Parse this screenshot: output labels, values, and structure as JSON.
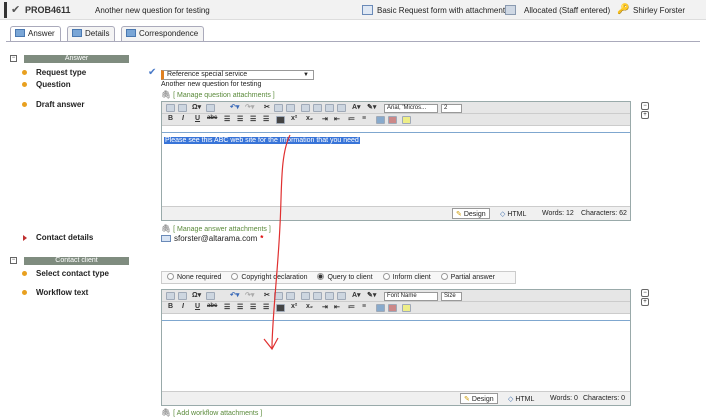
{
  "header": {
    "id": "PROB4611",
    "title": "Another new question for testing",
    "form": "Basic Request form with attachments",
    "status": "Allocated (Staff entered)",
    "user": "Shirley Forster"
  },
  "tabs": [
    {
      "label": "Answer"
    },
    {
      "label": "Details"
    },
    {
      "label": "Correspondence"
    }
  ],
  "answer_section": {
    "title": "Answer",
    "request_type_label": "Request type",
    "request_type_value": "Reference special service",
    "question_label": "Question",
    "question_value": "Another new question for testing",
    "manage_question_attachments": "[ Manage question attachments ]",
    "draft_answer_label": "Draft answer",
    "draft_text": "Please see this ABC web site for the information that you need",
    "manage_answer_attachments": "[ Manage answer attachments ]",
    "contact_details_label": "Contact details",
    "email": "sforster@altarama.com",
    "required_mark": "*"
  },
  "editor1": {
    "font": "Arial, 'Micros...",
    "size": "2",
    "design": "Design",
    "html": "HTML",
    "words": "Words: 12",
    "chars": "Characters: 62"
  },
  "contact_section": {
    "title": "Contact client",
    "select_contact_type_label": "Select contact type",
    "options": [
      "None required",
      "Copyright declaration",
      "Query to client",
      "Inform client",
      "Partial answer"
    ],
    "selected": "Query to client",
    "workflow_text_label": "Workflow text",
    "add_workflow_attachments": "[ Add workflow attachments ]"
  },
  "editor2": {
    "font": "Font Name",
    "size": "Size",
    "design": "Design",
    "html": "HTML",
    "words": "Words: 0",
    "chars": "Characters: 0"
  },
  "toolbar_row2": {
    "bold": "B",
    "italic": "I",
    "underline": "U",
    "strike": "abc",
    "sup": "x²",
    "sub": "x₂"
  },
  "colors": {
    "accent_orange": "#e8a020",
    "section_header": "#7f8c7f",
    "selection": "#3874d8",
    "annotation": "#e03030"
  }
}
